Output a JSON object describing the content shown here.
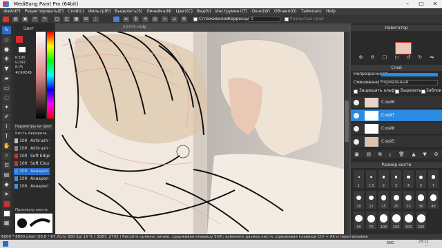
{
  "window": {
    "title": "MediBang Paint Pro (64bit)"
  },
  "menu": [
    "Файл(F)",
    "Редактировать(E)",
    "Слой(L)",
    "Фильтр(R)",
    "Выделить(S)",
    "Линейка(N)",
    "Цвет(C)",
    "Вид(V)",
    "Инструмент(T)",
    "Окно(W)",
    "Облако(O)",
    "Таймлапс",
    "Help"
  ],
  "toolbar": {
    "antialias_label": "Сглаживание",
    "correction_label": "Коррекция",
    "correction_value": "0",
    "blur_label": "Размытый край"
  },
  "color_panel": {
    "title": "Цвет",
    "r": "R:196",
    "g": "G:142",
    "b": "B:75",
    "hex": "#C48E4B"
  },
  "brush_panel": {
    "tabs": [
      "Параметры кисти",
      "Цвет"
    ],
    "header": "Кисть  Акварель",
    "items": [
      {
        "size": "100",
        "name": "Airbrush (",
        "color": "#bfbfbf"
      },
      {
        "size": "100",
        "name": "Airbrush (",
        "color": "#888888"
      },
      {
        "size": "100",
        "name": "Soft Edge",
        "color": "#d32f2f"
      },
      {
        "size": "100",
        "name": "Soft Clou",
        "color": "#d32f2f"
      },
      {
        "size": "300",
        "name": "Акварел",
        "color": "#3f8ee0",
        "selected": true
      },
      {
        "size": "100",
        "name": "Акварел",
        "color": "#3f8ee0"
      },
      {
        "size": "100",
        "name": "Акварел",
        "color": "#3f8ee0"
      }
    ],
    "preview_title": "Просмотр кисти"
  },
  "document": {
    "tab_name": "22375.mdp"
  },
  "right_panel": {
    "navigator_title": "Навигатор",
    "layer_title": "Слой",
    "opacity_label": "Непрозрачность",
    "blend_label": "Смешивание",
    "blend_value": "Нормальный",
    "protect_alpha": "Защищать альфа",
    "clip": "Вырезать",
    "lock": "Заблокир",
    "layers": [
      {
        "name": "Слой6",
        "selected": false
      },
      {
        "name": "Слой7",
        "selected": true
      },
      {
        "name": "Слой8",
        "selected": false
      },
      {
        "name": "Слой5",
        "selected": false
      }
    ],
    "brush_size_title": "Размер кисти",
    "brush_sizes": [
      "1",
      "1.5",
      "2",
      "3",
      "4",
      "5",
      "7",
      "10",
      "12",
      "15",
      "20",
      "25",
      "30",
      "40",
      "50",
      "70",
      "100",
      "150",
      "200",
      "300"
    ]
  },
  "status": "6000 * 8000 pixel  (50.8 * 67.7cm)  300 dpi  16 %  ( 3087, 2793 )  Рисуйте прямую линию, удерживая клавишу Shift; измените размер кисти, удерживая клавиши Ctrl + Alt и перетаскивая",
  "taskbar": {
    "time": "23:11",
    "date": "...",
    "lang": "ENG"
  }
}
